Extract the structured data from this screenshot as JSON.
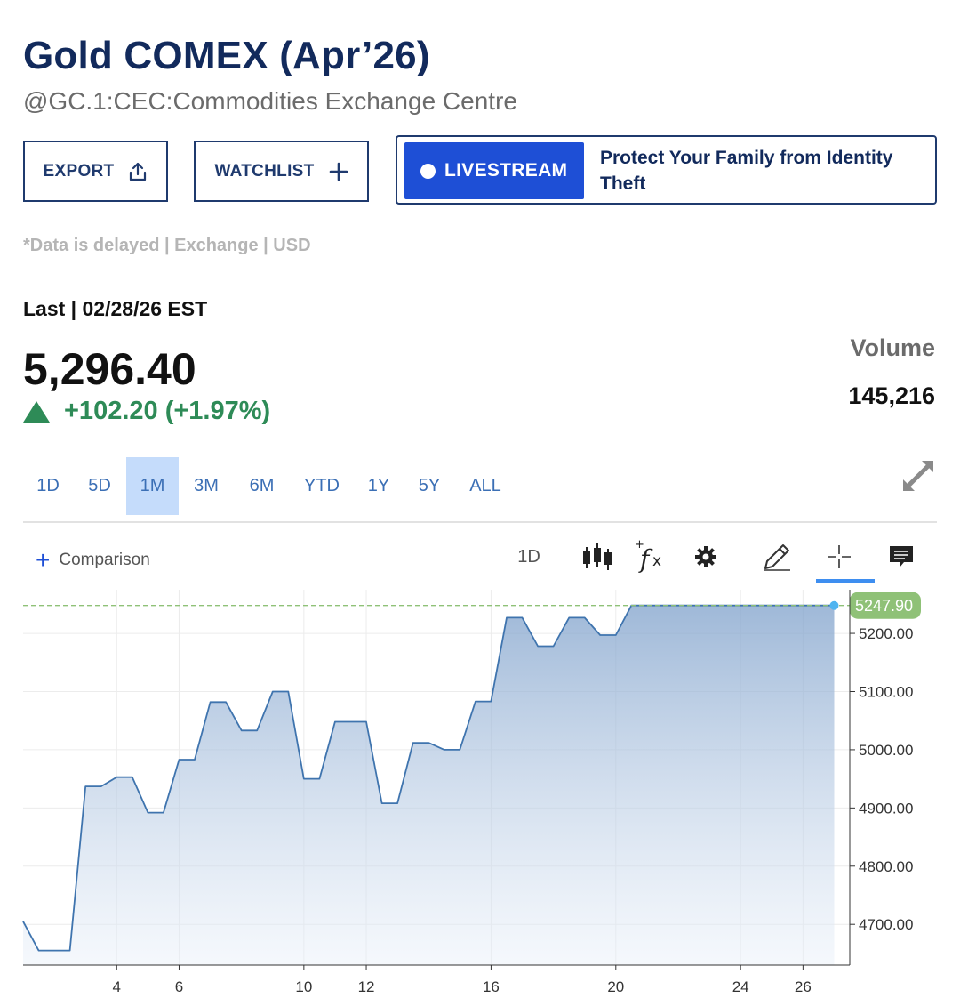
{
  "header": {
    "title": "Gold COMEX (Apr’26)",
    "subtitle": "@GC.1:CEC:Commodities Exchange Centre"
  },
  "actions": {
    "export_label": "EXPORT",
    "watchlist_label": "WATCHLIST",
    "export_icon": "share-upload-icon",
    "watchlist_icon": "plus-icon"
  },
  "promo": {
    "live_label": "LIVESTREAM",
    "text": "Protect Your Family from Identity Theft"
  },
  "quote": {
    "delayed_note": "*Data is delayed | Exchange | USD",
    "last_label": "Last | 02/28/26 EST",
    "price": "5,296.40",
    "change": "+102.20 (+1.97%)",
    "direction": "up",
    "volume_label": "Volume",
    "volume_value": "145,216"
  },
  "ranges": {
    "items": [
      "1D",
      "5D",
      "1M",
      "3M",
      "6M",
      "YTD",
      "1Y",
      "5Y",
      "ALL"
    ],
    "selected": "1M"
  },
  "toolbar": {
    "comparison_label": "Comparison",
    "interval_label": "1D",
    "icons": [
      "candlestick-icon",
      "function-fx-icon",
      "settings-gear-icon",
      "pencil-draw-icon",
      "crosshair-icon",
      "comment-icon"
    ],
    "active_icon": "crosshair-icon"
  },
  "colors": {
    "title": "#122a5c",
    "positive": "#2e8b57",
    "accent": "#1e4fd6",
    "line": "#3f74ae",
    "last_price_badge": "#8fc177"
  },
  "chart_data": {
    "type": "area",
    "x": [
      1,
      1.5,
      2.5,
      3,
      3.5,
      4,
      4.5,
      5,
      5.5,
      6,
      6.5,
      7,
      7.5,
      8,
      8.5,
      9,
      9.5,
      10,
      10.5,
      11,
      11.5,
      12,
      12.5,
      13,
      13.5,
      14,
      14.5,
      15,
      15.5,
      16,
      16.5,
      17,
      17.5,
      18,
      18.5,
      19,
      19.5,
      20,
      20.5,
      21,
      21.5,
      22,
      22.5,
      23,
      23.5,
      24,
      24.5,
      25,
      25.5,
      26,
      26.5,
      27
    ],
    "values": [
      4705,
      4655,
      4655,
      4937,
      4937,
      4953,
      4953,
      4892,
      4892,
      4983,
      4983,
      5082,
      5082,
      5033,
      5033,
      5100,
      5100,
      4950,
      4950,
      5048,
      5048,
      5048,
      4908,
      4908,
      5012,
      5012,
      5000,
      5000,
      5083,
      5083,
      5227,
      5227,
      5178,
      5178,
      5227,
      5227,
      5197,
      5197,
      5247.9,
      5247.9,
      5247.9,
      5247.9,
      5247.9,
      5247.9,
      5247.9,
      5247.9,
      5247.9,
      5247.9,
      5247.9,
      5247.9,
      5247.9,
      5247.9
    ],
    "xlim": [
      1,
      20.4
    ],
    "ylim": [
      4630,
      5275
    ],
    "x_ticks": [
      "4",
      "6",
      "10",
      "12",
      "16",
      "20",
      "24",
      "26"
    ],
    "y_ticks": [
      "4700.00",
      "4800.00",
      "4900.00",
      "5000.00",
      "5100.00",
      "5200.00"
    ],
    "last_value_label": "5247.90",
    "grid": true
  }
}
